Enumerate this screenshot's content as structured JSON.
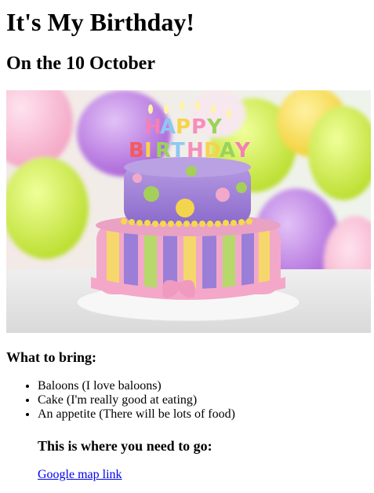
{
  "page": {
    "title": "It's My Birthday!",
    "date": "On the 10 October",
    "bring_heading": "What to bring:",
    "bring_items": [
      "Baloons (I love baloons)",
      "Cake (I'm really good at eating)",
      "An appetite (There will be lots of food)"
    ],
    "go_heading": "This is where you need to go:",
    "map_link": "Google map link"
  },
  "image": {
    "alt_subject": "birthday cake",
    "cake_lettering": "HAPPY BIRTHDAY"
  },
  "colors": {
    "link": "#0000ee"
  }
}
